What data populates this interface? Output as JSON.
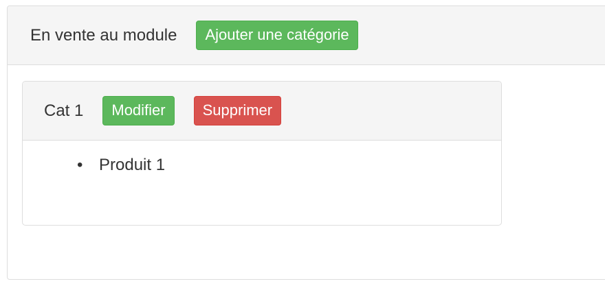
{
  "module_panel": {
    "title": "En vente au module",
    "add_category_label": "Ajouter une catégorie"
  },
  "categories": [
    {
      "name": "Cat 1",
      "edit_label": "Modifier",
      "delete_label": "Supprimer",
      "products": [
        "Produit 1"
      ]
    }
  ],
  "colors": {
    "success": "#5cb85c",
    "danger": "#d9534f",
    "heading_bg": "#f5f5f5",
    "border": "#dddddd"
  }
}
